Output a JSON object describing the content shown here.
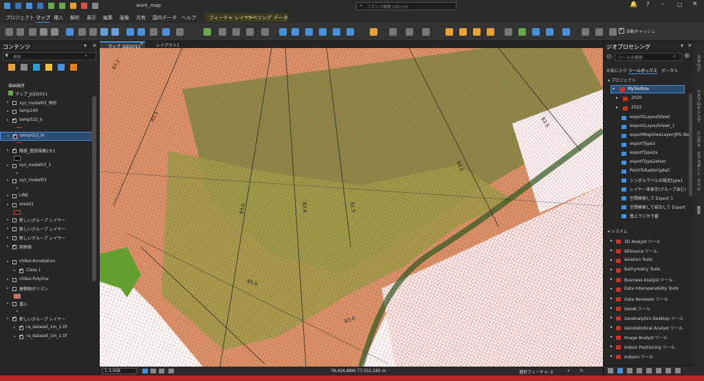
{
  "title": {
    "filename": "work_map",
    "search_placeholder": "コマンド検索 (Alt+Q)"
  },
  "menu": {
    "items": [
      "プロジェクト",
      "マップ",
      "挿入",
      "解析",
      "表示",
      "編集",
      "画像",
      "共有",
      "国内データ",
      "ヘルプ"
    ],
    "context_items": [
      "フィーチャ レイヤー",
      "ラベリング",
      "データ"
    ],
    "active": "マップ"
  },
  "toolbar": {
    "auto_save_label": "自動キャッシュ"
  },
  "contents": {
    "title": "コンテンツ",
    "search_placeholder": "検索",
    "drawing_order": "描画順序",
    "map_name": "マップ_JGD2011",
    "layers": [
      {
        "name": "xyz_model03_地形",
        "checked": false,
        "indent": 1,
        "symbol": "none"
      },
      {
        "name": "temp100",
        "checked": false,
        "indent": 1,
        "symbol": "none"
      },
      {
        "name": "temp022_II",
        "checked": true,
        "indent": 1,
        "symbol": "redline"
      },
      {
        "name": "temp022_III",
        "checked": true,
        "indent": 1,
        "symbol": "redline",
        "selected": true
      },
      {
        "name": "隣接_登録規模2大1",
        "checked": true,
        "indent": 1,
        "symbol": "blackbox"
      },
      {
        "name": "xyz_model03_1",
        "checked": false,
        "indent": 1,
        "symbol": "dot"
      },
      {
        "name": "xyz_model03",
        "checked": false,
        "indent": 1,
        "symbol": "dot"
      },
      {
        "name": "LINE",
        "checked": false,
        "indent": 1,
        "symbol": "none"
      },
      {
        "name": "area01",
        "checked": false,
        "indent": 1,
        "symbol": "redbox"
      },
      {
        "name": "新しいグループ レイヤー",
        "checked": false,
        "indent": 1,
        "symbol": "none"
      },
      {
        "name": "新しいグループ レイヤー",
        "checked": false,
        "indent": 1,
        "symbol": "none"
      },
      {
        "name": "新しいグループ レイヤー",
        "checked": false,
        "indent": 1,
        "symbol": "none"
      },
      {
        "name": "図郭線",
        "checked": true,
        "indent": 1,
        "symbol": "line"
      },
      {
        "name": "chikei-Annotation",
        "checked": false,
        "indent": 1,
        "symbol": "none"
      },
      {
        "name": "Class 1",
        "checked": true,
        "indent": 2,
        "symbol": "none"
      },
      {
        "name": "chikei-Polyline",
        "checked": false,
        "indent": 1,
        "symbol": "none"
      },
      {
        "name": "建築物ポリゴン",
        "checked": false,
        "indent": 1,
        "symbol": "pinkbox"
      },
      {
        "name": "重心",
        "checked": false,
        "indent": 1,
        "symbol": "dot"
      },
      {
        "name": "新しいグループ レイヤー",
        "checked": true,
        "indent": 1,
        "symbol": "none"
      },
      {
        "name": "ra_dataset_1m_1.tif",
        "checked": true,
        "indent": 2,
        "symbol": "none"
      },
      {
        "name": "ra_dataset_1m_1.tif",
        "checked": true,
        "indent": 2,
        "symbol": "none"
      }
    ]
  },
  "map": {
    "tabs": [
      "マップ_JGD2011",
      "レイアウト1"
    ],
    "active_tab": "マップ_JGD2011",
    "labels": [
      "83.2",
      "83.5",
      "83.0",
      "83.8",
      "81.5",
      "83.0",
      "83.5",
      "85.0",
      "83.0"
    ]
  },
  "status": {
    "scale": "1:3,008",
    "coordinates": "78,426.88W 77,551.285 m",
    "selected": "選択フィーチャ: 0"
  },
  "geoprocessing": {
    "title": "ジオプロセシング",
    "search_placeholder": "ツールの検索",
    "tabs": [
      "お気に入り",
      "ツールボックス",
      "ポータル"
    ],
    "active_tab": "ツールボックス",
    "project_label": "プロジェクト",
    "toolbox_name": "MyToolbox",
    "folders": [
      "2020",
      "2022"
    ],
    "tools": [
      "export(LayoutView)",
      "export(LayoutView)_1",
      "exportMapViewLayer(JPG Wo",
      "exportType2",
      "exportType2a",
      "exportType2atext",
      "PointToRaster(gdal)",
      "シンボルラベルの設定type1",
      "レイヤー非表示(グループ含む)",
      "空間検索して Export 1",
      "空間検索して結合して Export",
      "基上ラジカラ番"
    ],
    "system_label": "システム",
    "system_toolboxes": [
      "3D Analyst ツール",
      "AllSource ツール",
      "Aviation Tools",
      "Bathymetry Tools",
      "Business Analyst ツール",
      "Data Interoperability Tools",
      "Data Reviewer ツール",
      "GeoAI ツール",
      "GeoAnalytics Desktop ツール",
      "Geostatistical Analyst ツール",
      "Image Analyst ツール",
      "Indoor Positioning ツール",
      "Indoors ツール"
    ]
  },
  "side_tabs": [
    "カタログ",
    "ジオプロセシング",
    "シンボル",
    "エクスポート",
    "ラベル",
    "要素"
  ]
}
